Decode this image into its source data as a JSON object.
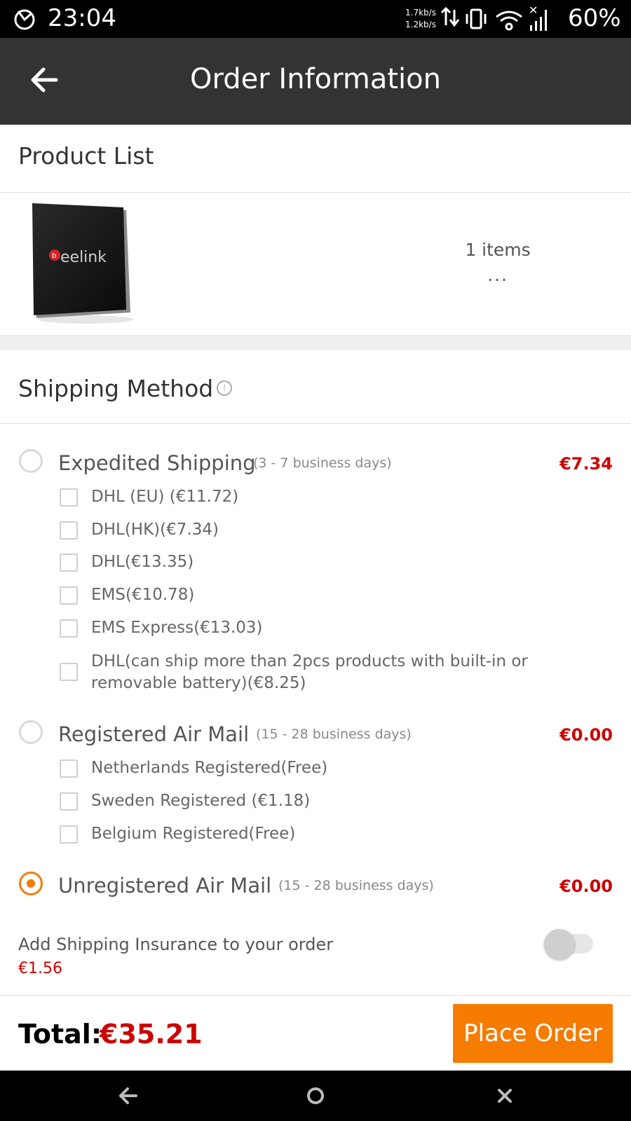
{
  "status_bar": {
    "time": "23:04",
    "speed_up": "1.7kb/s",
    "speed_down": "1.2kb/s",
    "battery": "60%"
  },
  "app_bar": {
    "title": "Order Information"
  },
  "product_list": {
    "title": "Product List",
    "product_brand": "beelink",
    "items_count": "1 items",
    "more": "..."
  },
  "shipping": {
    "title": "Shipping Method",
    "methods": [
      {
        "label": "Expedited Shipping",
        "days": "(3 - 7 business days)",
        "price": "€7.34",
        "selected": false,
        "options": [
          "DHL (EU) (€11.72)",
          "DHL(HK)(€7.34)",
          "DHL(€13.35)",
          "EMS(€10.78)",
          "EMS Express(€13.03)",
          "DHL(can ship more than 2pcs products with built-in or removable battery)(€8.25)"
        ]
      },
      {
        "label": "Registered Air Mail",
        "days": "(15 - 28 business days)",
        "price": "€0.00",
        "selected": false,
        "options": [
          "Netherlands Registered(Free)",
          "Sweden Registered (€1.18)",
          "Belgium Registered(Free)"
        ]
      },
      {
        "label": "Unregistered Air Mail",
        "days": "(15 - 28 business days)",
        "price": "€0.00",
        "selected": true,
        "options": []
      }
    ]
  },
  "insurance": {
    "label": "Add Shipping Insurance to your order",
    "price": "€1.56",
    "enabled": false
  },
  "footer": {
    "total_label": "Total:",
    "total_value": "€35.21",
    "place_order": "Place Order"
  },
  "colors": {
    "accent": "#f57c00",
    "price_red": "#cc0000",
    "app_bar": "#333333"
  },
  "icons": {
    "back": "arrow-left-icon",
    "info": "info-icon",
    "nav_back": "nav-back-icon",
    "nav_home": "nav-home-icon",
    "nav_close": "nav-close-icon"
  }
}
